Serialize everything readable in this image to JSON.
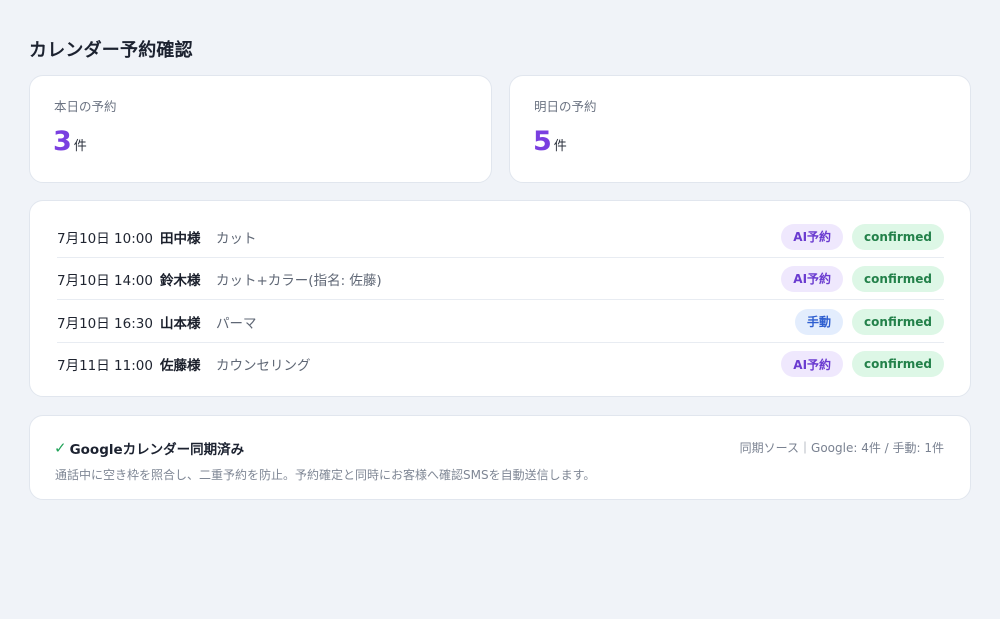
{
  "page": {
    "title": "カレンダー予約確認"
  },
  "stats": {
    "today": {
      "label": "本日の予約",
      "value": "3",
      "unit": "件"
    },
    "tomorrow": {
      "label": "明日の予約",
      "value": "5",
      "unit": "件"
    }
  },
  "bookings": [
    {
      "time": "7月10日 10:00",
      "name": "田中様",
      "service": "カット",
      "source": "AI予約",
      "status": "confirmed"
    },
    {
      "time": "7月10日 14:00",
      "name": "鈴木様",
      "service": "カット+カラー(指名: 佐藤)",
      "source": "AI予約",
      "status": "confirmed"
    },
    {
      "time": "7月10日 16:30",
      "name": "山本様",
      "service": "パーマ",
      "source": "手動",
      "status": "confirmed"
    },
    {
      "time": "7月11日 11:00",
      "name": "佐藤様",
      "service": "カウンセリング",
      "source": "AI予約",
      "status": "confirmed"
    }
  ],
  "sync": {
    "check_glyph": "✓",
    "title": "Googleカレンダー同期済み",
    "meta": "同期ソース｜Google: 4件 / 手動: 1件",
    "description": "通話中に空き枠を照合し、二重予約を防止。予約確定と同時にお客様へ確認SMSを自動送信します。"
  },
  "colors": {
    "accent": "#7a3fe0",
    "ai_badge_bg": "#efe8fd",
    "manual_badge_bg": "#e3edfd",
    "confirmed_badge_bg": "#ddf7e6",
    "check": "#22a35a"
  }
}
